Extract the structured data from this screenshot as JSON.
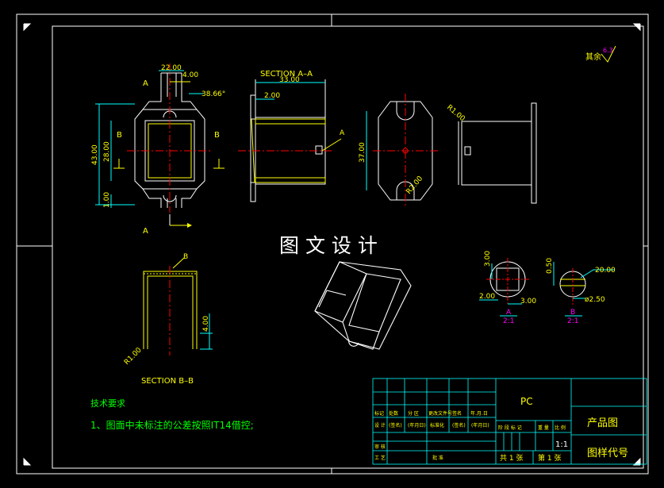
{
  "watermark": "图 文 设 计",
  "roughness": {
    "label": "其余",
    "value": "6.3"
  },
  "front_view": {
    "dims": {
      "width_top": "22.00",
      "slot": "4.00",
      "angle": "38.66°",
      "height": "43.00",
      "inner": "28.00",
      "offset": "1.00"
    },
    "labels": {
      "a_top": "A",
      "a_bottom": "A",
      "b_left": "B",
      "b_right": "B"
    }
  },
  "section_aa": {
    "title": "SECTION  A–A",
    "width": "33.00",
    "thickness": "2.00",
    "detail": "A"
  },
  "side_view": {
    "height": "37.00",
    "radius": "R2.00"
  },
  "right_view": {
    "radius": "R1.00"
  },
  "section_bb": {
    "title": "SECTION  B–B",
    "detail": "B",
    "height": "4.00",
    "radius": "R1.00"
  },
  "detail_a": {
    "d1": "3.00",
    "d2": "2.00",
    "d3": "3.00",
    "label": "A",
    "scale": "2:1"
  },
  "detail_b": {
    "d1": "0.50",
    "d2": "20.00",
    "d3": "ø2.50",
    "label": "B",
    "scale": "2:1"
  },
  "notes": {
    "heading": "技术要求",
    "line1": "1、图面中未标注的公差按照IT14借控;"
  },
  "title_block": {
    "material": "PC",
    "product": "产品图",
    "drawing_code": "图样代号",
    "scale": "1:1",
    "sheets_total": "共 1 张",
    "sheet_no": "第 1 张",
    "row_labels": [
      "标记",
      "处数",
      "分 区",
      "更改文件号",
      "签名",
      "年.月.日"
    ],
    "design_row": [
      "设 计",
      "(签名)",
      "(年月日)",
      "标准化",
      "(签名)",
      "(年月日)"
    ],
    "stage_labels": [
      "阶 段 标 记",
      "重 量",
      "比 例"
    ],
    "review": "审 核",
    "process": "工 艺",
    "approve": "批 准"
  }
}
